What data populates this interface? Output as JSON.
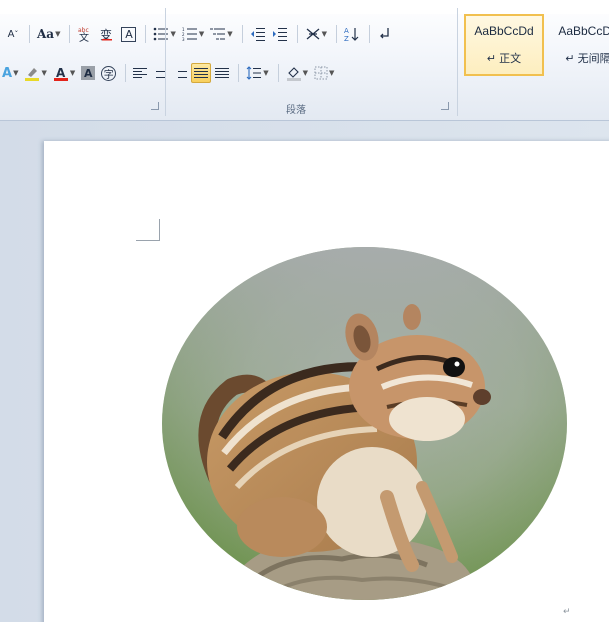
{
  "ribbon": {
    "font_row1": {
      "grow_font": "A",
      "change_case": "Aa",
      "phonetic_guide": "文",
      "char_border": "A",
      "char_shading": "A",
      "enclose_char": "字",
      "sort": "A↓",
      "show_marks": "↵",
      "font_color_letter": "A"
    },
    "paragraph_group_label": "段落",
    "styles": [
      {
        "sample": "AaBbCcDd",
        "name": "↵ 正文"
      },
      {
        "sample": "AaBbCcDd",
        "name": "↵ 无间隔"
      }
    ]
  },
  "document": {
    "paragraph_mark": "↵",
    "image_subject": "chipmunk-photo"
  },
  "colors": {
    "highlight": "#e8d928",
    "font_color": "#e2231a",
    "active_align": "#f8cf5c"
  }
}
